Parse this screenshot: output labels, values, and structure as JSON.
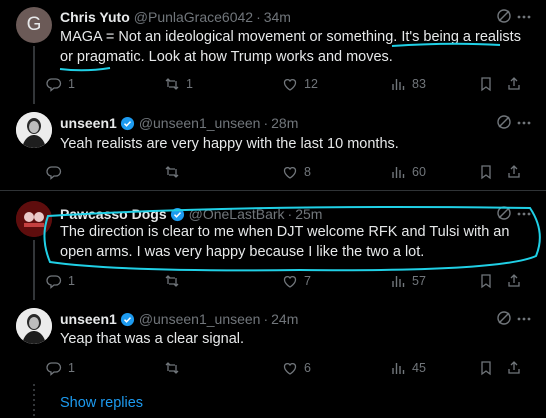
{
  "tweets": [
    {
      "avatar_letter": "G",
      "name": "Chris Yuto",
      "handle": "@PunlaGrace6042",
      "time": "34m",
      "text": "MAGA = Not an ideological movement or something. It's being a realists or pragmatic. Look at how Trump works and moves.",
      "replies": "1",
      "reposts": "1",
      "likes": "12",
      "views": "83"
    },
    {
      "name": "unseen1",
      "handle": "@unseen1_unseen",
      "time": "28m",
      "text": "Yeah realists are very happy with the last 10 months.",
      "replies": "",
      "reposts": "",
      "likes": "8",
      "views": "60"
    },
    {
      "name": "Pawcasso Dogs",
      "handle": "@OneLastBark",
      "time": "25m",
      "text": "The direction is clear to me when DJT welcome RFK and Tulsi with an open arms. I was very happy because I like the two a lot.",
      "replies": "1",
      "reposts": "",
      "likes": "7",
      "views": "57"
    },
    {
      "name": "unseen1",
      "handle": "@unseen1_unseen",
      "time": "24m",
      "text": "Yeap that was a clear signal.",
      "replies": "1",
      "reposts": "",
      "likes": "6",
      "views": "45"
    }
  ],
  "show_replies": "Show replies",
  "colors": {
    "accent": "#1d9bf0",
    "annotation": "#20d0e6"
  }
}
